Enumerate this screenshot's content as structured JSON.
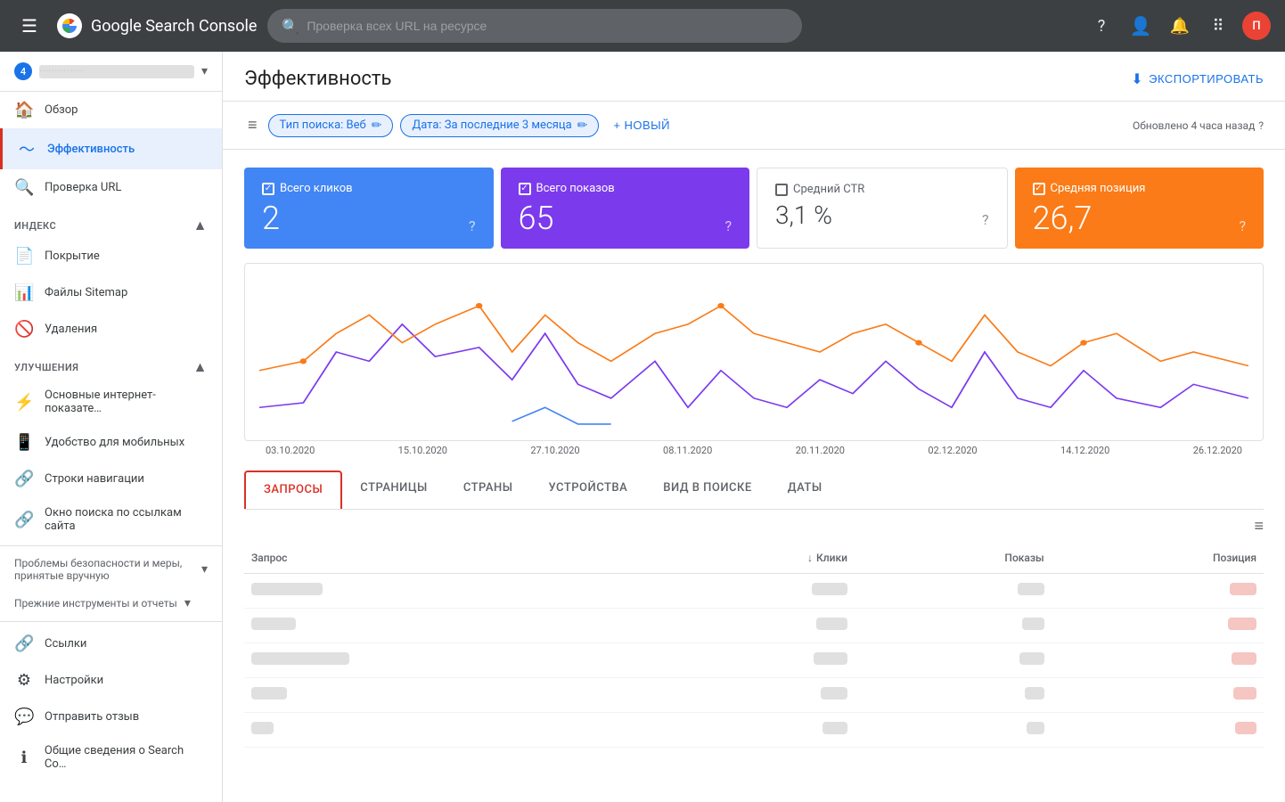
{
  "app": {
    "title": "Google Search Console",
    "search_placeholder": "Проверка всех URL на ресурсе"
  },
  "topnav": {
    "menu_label": "☰",
    "help_icon": "?",
    "accounts_icon": "👤",
    "notifications_icon": "🔔",
    "apps_icon": "⠿",
    "avatar_initials": "П"
  },
  "sidebar": {
    "property_num": "4",
    "property_name": "···············",
    "nav_items": [
      {
        "id": "overview",
        "label": "Обзор",
        "icon": "🏠"
      },
      {
        "id": "performance",
        "label": "Эффективность",
        "icon": "📈",
        "active": true
      },
      {
        "id": "url_inspection",
        "label": "Проверка URL",
        "icon": "🔍"
      }
    ],
    "index_section": "Индекс",
    "index_items": [
      {
        "id": "coverage",
        "label": "Покрытие",
        "icon": "📄"
      },
      {
        "id": "sitemaps",
        "label": "Файлы Sitemap",
        "icon": "📊"
      },
      {
        "id": "removals",
        "label": "Удаления",
        "icon": "🚫"
      }
    ],
    "improvements_section": "Улучшения",
    "improvements_items": [
      {
        "id": "core_vitals",
        "label": "Основные интернет-показате…",
        "icon": "⚡"
      },
      {
        "id": "mobile",
        "label": "Удобство для мобильных",
        "icon": "📱"
      },
      {
        "id": "breadcrumbs",
        "label": "Строки навигации",
        "icon": "🔗"
      },
      {
        "id": "sitelinks",
        "label": "Окно поиска по ссылкам сайта",
        "icon": "🔗"
      }
    ],
    "security_section": "Проблемы безопасности и меры, принятые вручную",
    "legacy_section": "Прежние инструменты и отчеты",
    "links_item": {
      "id": "links",
      "label": "Ссылки",
      "icon": "🔗"
    },
    "settings_item": {
      "id": "settings",
      "label": "Настройки",
      "icon": "⚙"
    },
    "feedback_item": {
      "id": "feedback",
      "label": "Отправить отзыв",
      "icon": "💬"
    },
    "about_item": {
      "id": "about",
      "label": "Общие сведения о Search Co…",
      "icon": "ℹ"
    }
  },
  "page": {
    "title": "Эффективность",
    "export_label": "ЭКСПОРТИРОВАТЬ",
    "updated_text": "Обновлено 4 часа назад",
    "filter_type_label": "Тип поиска: Веб",
    "filter_date_label": "Дата: За последние 3 месяца",
    "new_label": "НОВЫЙ"
  },
  "metrics": [
    {
      "id": "clicks",
      "label": "Всего кликов",
      "value": "2",
      "checked": true,
      "color": "blue"
    },
    {
      "id": "impressions",
      "label": "Всего показов",
      "value": "65",
      "checked": true,
      "color": "purple"
    },
    {
      "id": "ctr",
      "label": "Средний CTR",
      "value": "3,1 %",
      "checked": false,
      "color": "white"
    },
    {
      "id": "position",
      "label": "Средняя позиция",
      "value": "26,7",
      "checked": true,
      "color": "orange"
    }
  ],
  "chart": {
    "dates": [
      "03.10.2020",
      "15.10.2020",
      "27.10.2020",
      "08.11.2020",
      "20.11.2020",
      "02.12.2020",
      "14.12.2020",
      "26.12.2020"
    ]
  },
  "tabs": [
    {
      "id": "queries",
      "label": "ЗАПРОСЫ",
      "active": true
    },
    {
      "id": "pages",
      "label": "СТРАНИЦЫ",
      "active": false
    },
    {
      "id": "countries",
      "label": "СТРАНЫ",
      "active": false
    },
    {
      "id": "devices",
      "label": "УСТРОЙСТВА",
      "active": false
    },
    {
      "id": "search_type",
      "label": "ВИД В ПОИСКЕ",
      "active": false
    },
    {
      "id": "dates",
      "label": "ДАТЫ",
      "active": false
    }
  ],
  "table": {
    "col_query": "Запрос",
    "col_clicks": "Клики",
    "col_impressions": "Показы",
    "col_position": "Позиция",
    "rows": [
      {
        "query_w": 80,
        "clicks_w": 40,
        "impressions_w": 30,
        "position_w": 30,
        "position_color": "salmon"
      },
      {
        "query_w": 50,
        "clicks_w": 35,
        "impressions_w": 25,
        "position_w": 32,
        "position_color": "salmon"
      },
      {
        "query_w": 110,
        "clicks_w": 38,
        "impressions_w": 28,
        "position_w": 28,
        "position_color": "salmon"
      },
      {
        "query_w": 40,
        "clicks_w": 30,
        "impressions_w": 22,
        "position_w": 26,
        "position_color": "salmon"
      },
      {
        "query_w": 25,
        "clicks_w": 28,
        "impressions_w": 20,
        "position_w": 24,
        "position_color": "salmon"
      }
    ]
  }
}
